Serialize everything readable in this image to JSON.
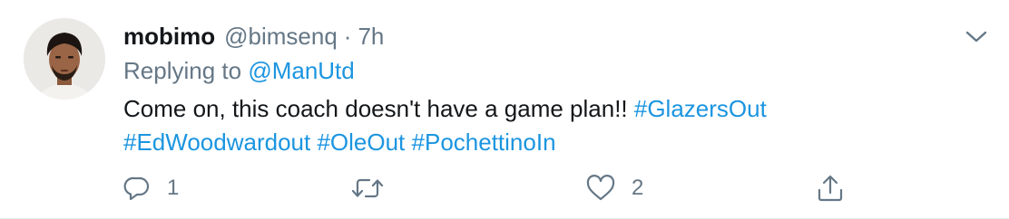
{
  "tweet": {
    "display_name": "mobimo",
    "handle": "@bimsenq",
    "separator": "·",
    "time": "7h",
    "replying_prefix": "Replying to",
    "replying_to": "@ManUtd",
    "text": "Come on, this coach doesn't have a game plan!!",
    "hashtags": [
      "#GlazersOut",
      "#EdWoodwardout",
      "#OleOut",
      "#PochettinoIn"
    ]
  },
  "actions": {
    "reply_count": "1",
    "retweet_count": "",
    "like_count": "2"
  },
  "colors": {
    "link": "#1b95e0",
    "secondary_text": "#657786",
    "primary_text": "#14171a"
  },
  "icons": [
    "chevron-down-icon",
    "reply-icon",
    "retweet-icon",
    "like-icon",
    "share-icon"
  ]
}
